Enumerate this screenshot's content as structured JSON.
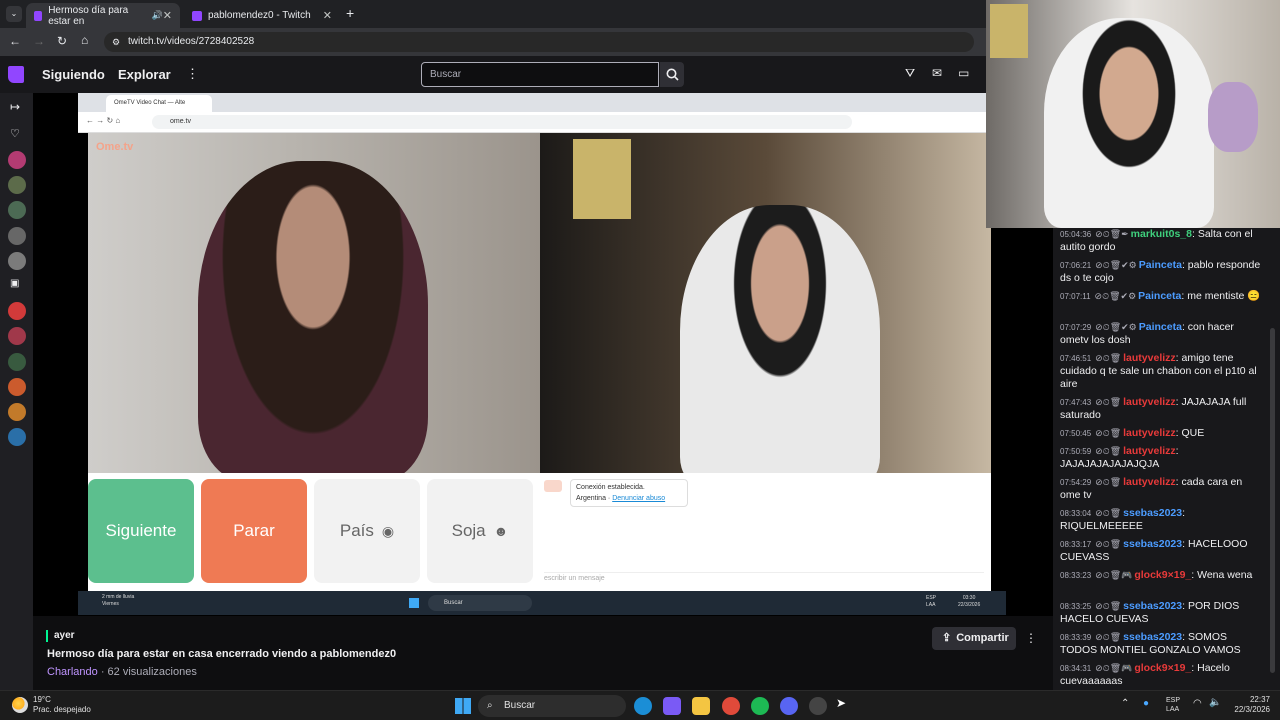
{
  "browser": {
    "tabs": [
      {
        "title": "Hermoso día para estar en",
        "active": true
      },
      {
        "title": "pablomendez0 - Twitch",
        "active": false
      }
    ],
    "url": "twitch.tv/videos/2728402528"
  },
  "topnav": {
    "following": "Siguiendo",
    "browse": "Explorar",
    "search_placeholder": "Buscar"
  },
  "ometv": {
    "tab_title": "OmeTV Video Chat — Alte",
    "url": "ome.tv",
    "logo": "Ome.tv",
    "buttons": {
      "next": "Siguiente",
      "stop": "Parar",
      "country": "País",
      "gender": "Soja"
    },
    "connection": "Conexión establecida.",
    "country_line": "Argentina",
    "report": "Denunciar abuso",
    "message_placeholder": "escribir un mensaje",
    "weather": "2 mm de lluvia",
    "weather_day": "Viernes",
    "search": "Buscar",
    "lang": "ESP",
    "lang2": "LAA",
    "time": "03:30",
    "date": "22/3/2026"
  },
  "vod_info": {
    "date": "ayer",
    "title": "Hermoso día para estar en casa encerrado viendo a pablomendez0",
    "category": "Charlando",
    "views": "62 visualizaciones",
    "share": "Compartir"
  },
  "chat": [
    {
      "ts": "05:04:36",
      "user": "markuit0s_8",
      "color": "#3fd07d",
      "text": "Salta con el autito gordo",
      "badges": "⊘⏲🗑✒"
    },
    {
      "ts": "07:06:21",
      "user": "Painceta",
      "color": "#4c9cff",
      "text": "pablo responde ds o te cojo",
      "badges": "⊘⏲🗑✔⚙"
    },
    {
      "ts": "07:07:11",
      "user": "Painceta",
      "color": "#4c9cff",
      "text": "me mentiste 😑",
      "badges": "⊘⏲🗑✔⚙"
    },
    {
      "ts": "07:07:29",
      "user": "Painceta",
      "color": "#4c9cff",
      "text": "con hacer ometv los dosh",
      "badges": "⊘⏲🗑✔⚙"
    },
    {
      "ts": "07:46:51",
      "user": "lautyvelizz",
      "color": "#e83a3a",
      "text": "amigo tene cuidado q te sale un chabon con el p1t0 al aire",
      "badges": "⊘⏲🗑"
    },
    {
      "ts": "07:47:43",
      "user": "lautyvelizz",
      "color": "#e83a3a",
      "text": "JAJAJAJA full saturado",
      "badges": "⊘⏲🗑"
    },
    {
      "ts": "07:50:45",
      "user": "lautyvelizz",
      "color": "#e83a3a",
      "text": "QUE",
      "badges": "⊘⏲🗑"
    },
    {
      "ts": "07:50:59",
      "user": "lautyvelizz",
      "color": "#e83a3a",
      "text": "JAJAJAJAJAJAJQJA",
      "badges": "⊘⏲🗑"
    },
    {
      "ts": "07:54:29",
      "user": "lautyvelizz",
      "color": "#e83a3a",
      "text": "cada cara en ome tv",
      "badges": "⊘⏲🗑"
    },
    {
      "ts": "08:33:04",
      "user": "ssebas2023",
      "color": "#4c9cff",
      "text": "RIQUELMEEEEE",
      "badges": "⊘⏲🗑"
    },
    {
      "ts": "08:33:17",
      "user": "ssebas2023",
      "color": "#4c9cff",
      "text": "HACELOOO CUEVASS",
      "badges": "⊘⏲🗑"
    },
    {
      "ts": "08:33:23",
      "user": "glock9×19_",
      "color": "#e83a3a",
      "text": "Wena wena",
      "badges": "⊘⏲🗑🎮"
    },
    {
      "ts": "08:33:25",
      "user": "ssebas2023",
      "color": "#4c9cff",
      "text": "POR DIOS HACELO CUEVAS",
      "badges": "⊘⏲🗑"
    },
    {
      "ts": "08:33:39",
      "user": "ssebas2023",
      "color": "#4c9cff",
      "text": "SOMOS TODOS MONTIEL GONZALO VAMOS",
      "badges": "⊘⏲🗑"
    },
    {
      "ts": "08:34:31",
      "user": "glock9×19_",
      "color": "#e83a3a",
      "text": "Hacelo cuevaaaaaas",
      "badges": "⊘⏲🗑🎮"
    }
  ],
  "os_taskbar": {
    "temp": "19°C",
    "weather": "Prac. despejado",
    "search": "Buscar",
    "lang": "ESP",
    "lang2": "LAA",
    "time": "22:37",
    "date": "22/3/2026"
  },
  "colors": {
    "twitch_purple": "#9146ff",
    "next_green": "#5cbf8e",
    "stop_orange": "#ef7a54"
  }
}
